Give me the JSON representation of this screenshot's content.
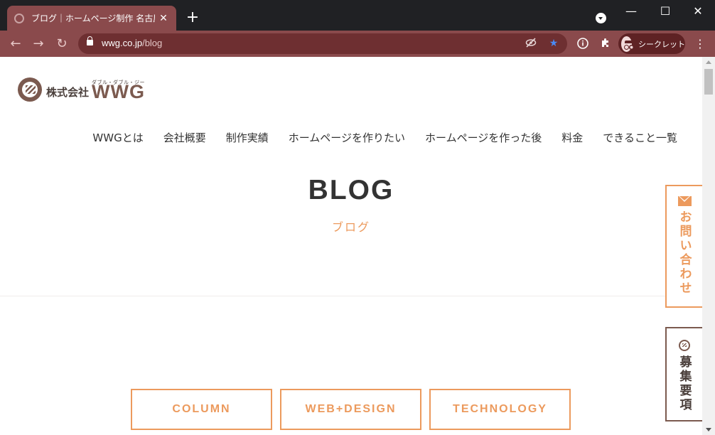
{
  "browser": {
    "tab_title": "ブログ｜ホームページ制作 名古屋 愛",
    "tab_close": "✕",
    "new_tab": "+",
    "url_host": "wwg.co.jp",
    "url_path": "/blog",
    "incognito_label": "シークレット",
    "icons": [
      "back-icon",
      "forward-icon",
      "reload-icon",
      "lock-icon",
      "eye-off-icon",
      "star-icon",
      "info-icon",
      "extensions-icon",
      "incognito-icon",
      "menu-icon"
    ]
  },
  "site": {
    "logo": {
      "company": "株式会社",
      "name": "WWG",
      "ruby": "ダブル・ダブル・ジー"
    },
    "nav": [
      "WWGとは",
      "会社概要",
      "制作実績",
      "ホームページを作りたい",
      "ホームページを作った後",
      "料金",
      "できること一覧"
    ],
    "hero": {
      "title": "BLOG",
      "subtitle": "ブログ"
    },
    "categories": [
      "COLUMN",
      "WEB+DESIGN",
      "TECHNOLOGY"
    ],
    "side_contact": "お問い合わせ",
    "side_recruit": "募集要項"
  },
  "colors": {
    "accent": "#ec9a5d",
    "brand": "#7b5a4f",
    "tab": "#8a4a4c",
    "toolbar": "#8a4a4c"
  }
}
